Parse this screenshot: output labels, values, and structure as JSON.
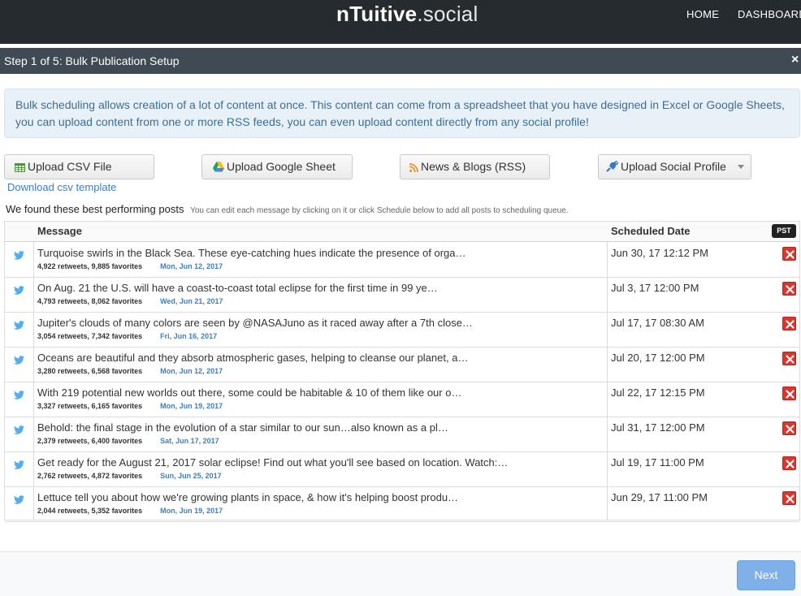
{
  "header": {
    "brand_bold": "nTuitive",
    "brand_light": ".social",
    "nav": [
      "HOME",
      "DASHBOARD"
    ]
  },
  "modal": {
    "title": "Step 1 of 5: Bulk Publication Setup",
    "close": "×"
  },
  "info_text": "Bulk scheduling allows creation of a lot of content at once. This content can come from a spreadsheet that you have designed in Excel or Google Sheets, you can upload content from one or more RSS feeds, you can even upload content directly from any social profile!",
  "upload_buttons": {
    "csv": "Upload CSV File",
    "google_sheet": "Upload Google Sheet",
    "rss": "News & Blogs (RSS)",
    "social": "Upload Social Profile"
  },
  "download_link": "Download csv template",
  "found": {
    "title": "We found these best performing posts",
    "hint": "You can edit each message by clicking on it or click Schedule below to add all posts to scheduling queue."
  },
  "table": {
    "col_message": "Message",
    "col_date": "Scheduled Date",
    "timezone": "PST",
    "rows": [
      {
        "message": "Turquoise swirls in the Black Sea. These eye-catching hues indicate the presence of orga…",
        "stats": "4,922 retweets, 9,885 favorites",
        "posted": "Mon, Jun 12, 2017",
        "scheduled": "Jun 30, 17 12:12 PM"
      },
      {
        "message": "On Aug. 21 the U.S. will have a coast-to-coast total eclipse for the first time in 99 ye…",
        "stats": "4,793 retweets, 8,062 favorites",
        "posted": "Wed, Jun 21, 2017",
        "scheduled": "Jul 3, 17 12:00 PM"
      },
      {
        "message": "Jupiter's clouds of many colors are seen by @NASAJuno as it raced away after a 7th close…",
        "stats": "3,054 retweets, 7,342 favorites",
        "posted": "Fri, Jun 16, 2017",
        "scheduled": "Jul 17, 17 08:30 AM"
      },
      {
        "message": "Oceans are beautiful and they absorb atmospheric gases, helping to cleanse our planet, a…",
        "stats": "3,280 retweets, 6,568 favorites",
        "posted": "Mon, Jun 12, 2017",
        "scheduled": "Jul 20, 17 12:00 PM"
      },
      {
        "message": "With 219 potential new worlds out there, some could be habitable & 10 of them like our o…",
        "stats": "3,327 retweets, 6,165 favorites",
        "posted": "Mon, Jun 19, 2017",
        "scheduled": "Jul 22, 17 12:15 PM"
      },
      {
        "message": "Behold: the final stage in the evolution of a star similar to our sun…also known as a pl…",
        "stats": "2,379 retweets, 6,400 favorites",
        "posted": "Sat, Jun 17, 2017",
        "scheduled": "Jul 31, 17 12:00 PM"
      },
      {
        "message": "Get ready for the August 21, 2017 solar eclipse! Find out what you'll see based on location. Watch:…",
        "stats": "2,762 retweets, 4,872 favorites",
        "posted": "Sun, Jun 25, 2017",
        "scheduled": "Jul 19, 17 11:00 PM"
      },
      {
        "message": "Lettuce tell you about how we're growing plants in space, & how it's helping boost produ…",
        "stats": "2,044 retweets, 5,352 favorites",
        "posted": "Mon, Jun 19, 2017",
        "scheduled": "Jun 29, 17 11:00 PM"
      }
    ]
  },
  "next_button": "Next",
  "colors": {
    "topbar": "#262b2f",
    "modal_header": "#3f4a54",
    "info_bg": "#e8f1f8",
    "link": "#3c7fc0",
    "twitter": "#55acee",
    "delete": "#d9362d",
    "next": "#7fb0e8"
  },
  "icons": {
    "csv": "table-icon",
    "google_sheet": "google-drive-icon",
    "rss": "rss-icon",
    "social": "plug-icon",
    "row": "twitter-bird-icon",
    "delete": "delete-x-icon"
  }
}
